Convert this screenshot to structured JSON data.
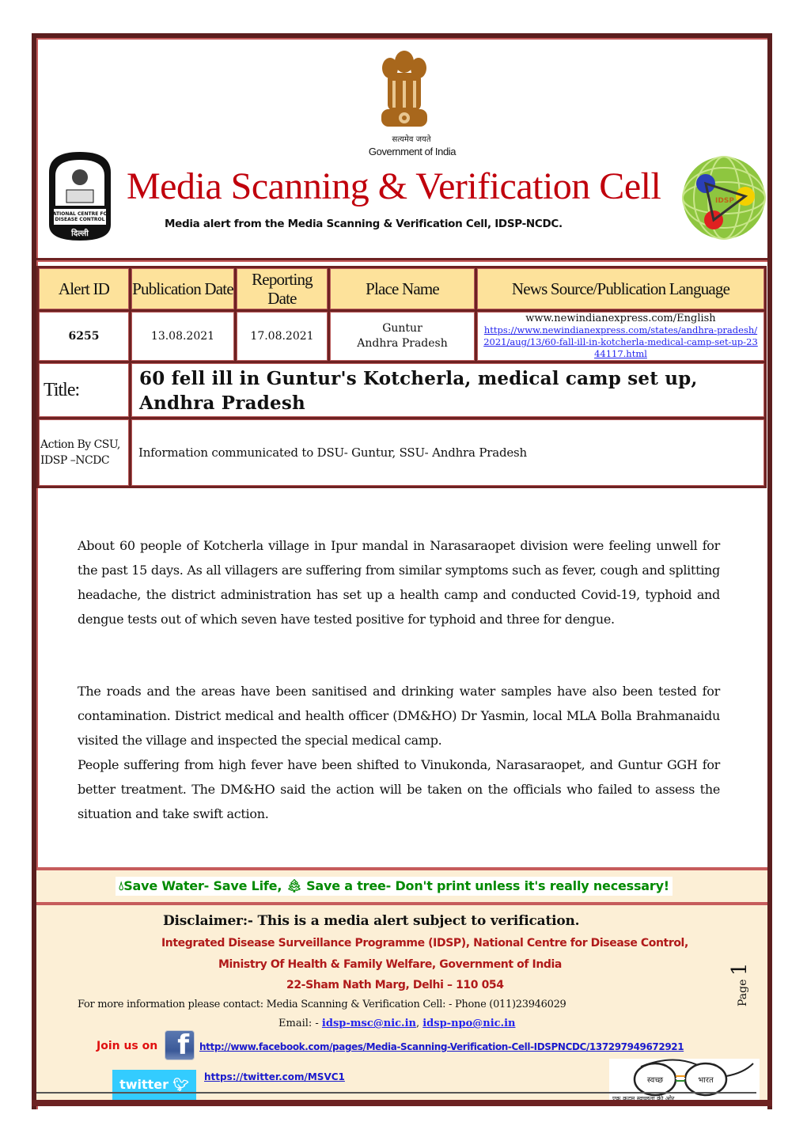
{
  "header": {
    "emblem_caption_hindi": "सत्यमेव जयते",
    "emblem_caption": "Government of India",
    "title": "Media Scanning & Verification Cell",
    "subtitle": "Media alert from the Media Scanning & Verification Cell, IDSP-NCDC.",
    "left_logo": "ncdc-logo",
    "right_logo": "idsp-logo",
    "right_logo_text": "IDSP"
  },
  "table": {
    "headers": {
      "alert_id": "Alert ID",
      "publication_date": "Publication Date",
      "reporting_date": "Reporting Date",
      "place_name": "Place Name",
      "news_source": "News Source/Publication Language"
    },
    "row": {
      "alert_id": "6255",
      "publication_date": "13.08.2021",
      "reporting_date": "17.08.2021",
      "place_district": "Guntur",
      "place_state": "Andhra Pradesh",
      "source_site": "www.newindianexpress.com/English",
      "source_url": "https://www.newindianexpress.com/states/andhra-pradesh/2021/aug/13/60-fall-ill-in-kotcherla-medical-camp-set-up-2344117.html"
    },
    "title_label": "Title:",
    "title_text": "60 fell ill in Guntur's Kotcherla, medical camp set up, Andhra Pradesh",
    "action_label": "Action By CSU, IDSP –NCDC",
    "action_text": "Information communicated to DSU- Guntur, SSU- Andhra Pradesh"
  },
  "body": {
    "paragraphs": [
      "About 60 people of Kotcherla village in Ipur mandal in Narasaraopet division were feeling unwell for the past 15 days. As all villagers are suffering from similar symptoms such as fever, cough and splitting headache, the district administration has set up a health camp and conducted Covid-19, typhoid and dengue tests out of which seven have tested positive for typhoid and three for dengue.",
      "The roads and the areas have been sanitised and drinking water samples have also been tested for contamination. District medical and health officer (DM&HO) Dr Yasmin, local MLA Bolla Brahmanaidu visited the village and inspected the special medical camp.",
      "People suffering from high fever have been shifted to Vinukonda, Narasaraopet, and Guntur GGH for better treatment. The DM&HO said the action will be taken on the officials who failed to assess the situation and take swift action."
    ]
  },
  "footer": {
    "eco_water": "Save Water- Save Life, ",
    "eco_tree": " Save a tree- Don't print unless it's really necessary!",
    "disclaimer": "Disclaimer:- This is a media alert subject to verification.",
    "org_line1": "Integrated Disease Surveillance Programme (IDSP), National Centre for Disease Control,",
    "org_line2": "Ministry Of Health & Family Welfare, Government of India",
    "org_line3": "22-Sham Nath Marg, Delhi – 110 054",
    "contact": "For more information please contact: Media Scanning & Verification Cell: - Phone (011)23946029",
    "email_label": "Email: - ",
    "email1": "idsp-msc@nic.in",
    "email_sep": ", ",
    "email2": "idsp-npo@nic.in",
    "join_label": "Join us on",
    "facebook_url": "http://www.facebook.com/pages/Media-Scanning-Verification-Cell-IDSPNCDC/137297949672921",
    "twitter_label": "twitter",
    "twitter_url": "https://twitter.com/MSVC1",
    "page_label": "Page",
    "page_number": "1",
    "swachh_left": "स्वच्छ",
    "swachh_right": "भारत",
    "swachh_tagline": "एक कदम स्वच्छता की ओर"
  },
  "colors": {
    "title_red": "#c0000c",
    "border_maroon": "#6d2222",
    "header_cell_bg": "#fde29b",
    "eco_green": "#008a00",
    "org_red": "#b01a1a",
    "link_blue": "#2222ee",
    "footer_bg": "#fcefd6"
  }
}
